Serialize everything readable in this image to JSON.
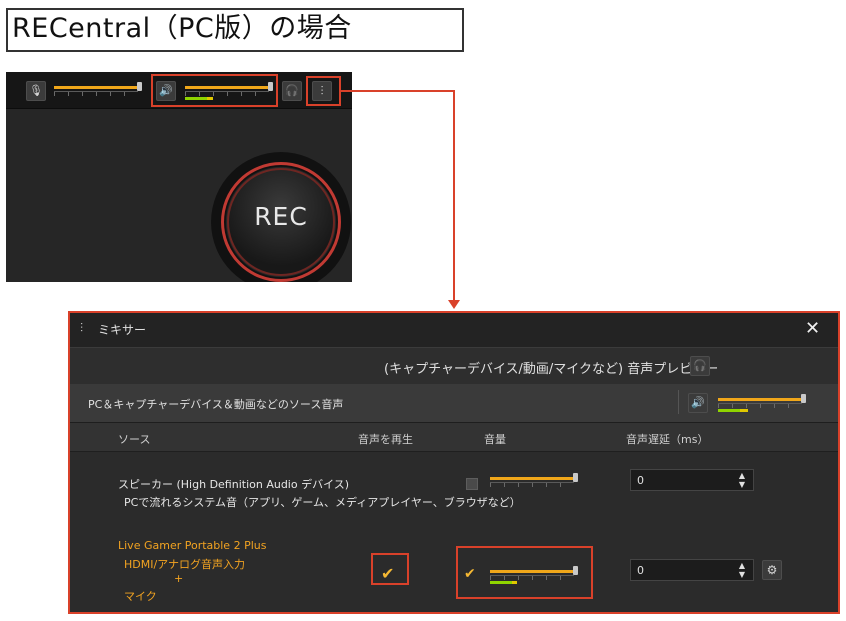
{
  "heading": {
    "title": "RECentral（PC版）の場合"
  },
  "recentral": {
    "rec_label": "REC",
    "icons": {
      "mic": "microphone-icon",
      "speaker": "speaker-icon",
      "headphones": "headphones-icon",
      "mixer": "mixer-icon"
    }
  },
  "mixer": {
    "title": "ミキサー",
    "close": "✕",
    "preview_label": "(キャプチャーデバイス/動画/マイクなど) 音声プレビュー",
    "source_section_label": "PC＆キャプチャーデバイス＆動画などのソース音声",
    "columns": {
      "source": "ソース",
      "play": "音声を再生",
      "volume": "音量",
      "delay": "音声遅延（ms）"
    },
    "rows": [
      {
        "name": "スピーカー (High Definition Audio デバイス)",
        "description": "PCで流れるシステム音（アプリ、ゲーム、メディアプレイヤー、ブラウザなど）",
        "play_checked": false,
        "volume": 1.0,
        "delay": "0"
      },
      {
        "name": "Live Gamer Portable 2 Plus",
        "line2": "HDMI/アナログ音声入力",
        "line3": "+",
        "line4": "マイク",
        "play_checked": true,
        "volume": 1.0,
        "delay": "0"
      }
    ]
  },
  "colors": {
    "accent_orange": "#f0a71a",
    "highlight_red": "#d9412a",
    "meter_green": "#8fd400",
    "text_orange": "#f2a321"
  }
}
